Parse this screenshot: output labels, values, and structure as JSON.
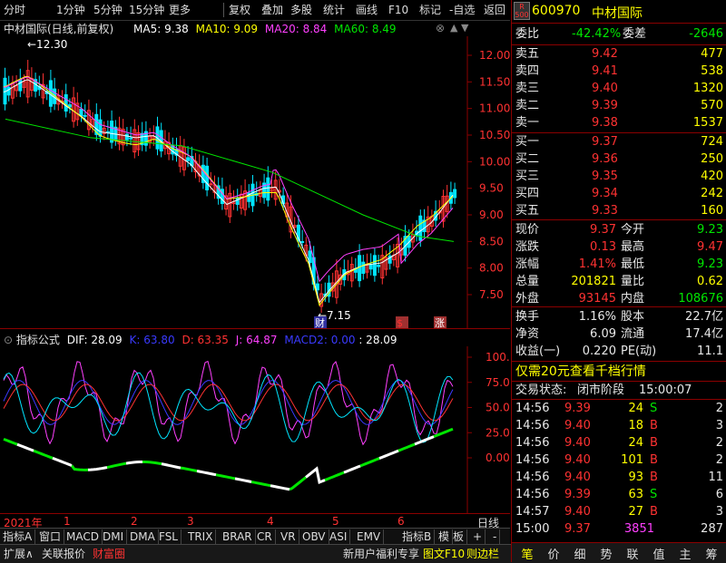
{
  "toolbar": {
    "items": [
      "分时",
      "1分钟",
      "5分钟",
      "15分钟",
      "更多",
      "复权",
      "叠加",
      "多股",
      "统计",
      "画线",
      "F10",
      "标记",
      "-自选",
      "返回"
    ]
  },
  "chart": {
    "title": "中材国际(日线,前复权)",
    "ma5_label": "MA5: 9.38",
    "ma10_label": "MA10: 9.09",
    "ma20_label": "MA20: 8.84",
    "ma60_label": "MA60: 8.49",
    "high_mark": "12.30",
    "low_mark": "7.15",
    "price_axis": [
      "12.00",
      "11.50",
      "11.00",
      "10.50",
      "10.00",
      "9.50",
      "9.00",
      "8.50",
      "8.00",
      "7.50"
    ],
    "markers": [
      "财",
      "$",
      "涨"
    ],
    "colors": {
      "up": "#ff3232",
      "down": "#00e5ff",
      "ma5": "#ffffff",
      "ma10": "#ffff00",
      "ma20": "#ff40ff",
      "ma60": "#00e600"
    }
  },
  "indicator": {
    "title": "指标公式",
    "dif_label": "DIF: 28.09",
    "k_label": "K: 63.80",
    "d_label": "D: 63.35",
    "j_label": "J: 64.87",
    "macd2_label": "MACD2: 0.00",
    "last_label": ": 28.09",
    "axis": [
      "100.0",
      "75.00",
      "50.00",
      "25.00",
      "0.00"
    ]
  },
  "time_axis": {
    "year": "2021年",
    "months": [
      "1",
      "2",
      "3",
      "4",
      "5",
      "6"
    ],
    "right_label": "日线"
  },
  "tabs": [
    "指标A",
    "窗口",
    "MACD",
    "DMI",
    "DMA",
    "FSL",
    "TRIX",
    "BRAR",
    "CR",
    "VR",
    "OBV",
    "ASI",
    "EMV",
    "指标B",
    "模",
    "板",
    "+",
    "-"
  ],
  "status_bar": {
    "left": [
      "扩展∧",
      "关联报价",
      "财富圈"
    ],
    "right": [
      "新用户福利专享",
      "图文F10",
      "则边栏"
    ]
  },
  "quote": {
    "code_badge_top": "R",
    "code_badge_bottom": "500",
    "code": "600970",
    "name": "中材国际",
    "weibi_label": "委比",
    "weibi_value": "-42.42%",
    "weicha_label": "委差",
    "weicha_value": "-2646",
    "asks": [
      {
        "label": "卖五",
        "price": "9.42",
        "vol": "477"
      },
      {
        "label": "卖四",
        "price": "9.41",
        "vol": "538"
      },
      {
        "label": "卖三",
        "price": "9.40",
        "vol": "1320"
      },
      {
        "label": "卖二",
        "price": "9.39",
        "vol": "570"
      },
      {
        "label": "卖一",
        "price": "9.38",
        "vol": "1537"
      }
    ],
    "bids": [
      {
        "label": "买一",
        "price": "9.37",
        "vol": "724"
      },
      {
        "label": "买二",
        "price": "9.36",
        "vol": "250"
      },
      {
        "label": "买三",
        "price": "9.35",
        "vol": "420"
      },
      {
        "label": "买四",
        "price": "9.34",
        "vol": "242"
      },
      {
        "label": "买五",
        "price": "9.33",
        "vol": "160"
      }
    ],
    "stats": [
      {
        "l1": "现价",
        "v1": "9.37",
        "l2": "今开",
        "v2": "9.23",
        "c1": "red",
        "c2": "green"
      },
      {
        "l1": "涨跌",
        "v1": "0.13",
        "l2": "最高",
        "v2": "9.47",
        "c1": "red",
        "c2": "red"
      },
      {
        "l1": "涨幅",
        "v1": "1.41%",
        "l2": "最低",
        "v2": "9.23",
        "c1": "red",
        "c2": "green"
      },
      {
        "l1": "总量",
        "v1": "201821",
        "l2": "量比",
        "v2": "0.62",
        "c1": "yellow",
        "c2": "yellow"
      },
      {
        "l1": "外盘",
        "v1": "93145",
        "l2": "内盘",
        "v2": "108676",
        "c1": "red",
        "c2": "green"
      }
    ],
    "stats2": [
      {
        "l1": "换手",
        "v1": "1.16%",
        "l2": "股本",
        "v2": "22.7亿"
      },
      {
        "l1": "净资",
        "v1": "6.09",
        "l2": "流通",
        "v2": "17.4亿"
      },
      {
        "l1": "收益(一)",
        "v1": "0.220",
        "l2": "PE(动)",
        "v2": "11.1"
      }
    ],
    "promo": "仅需20元查看千档行情",
    "trade_status_label": "交易状态:",
    "trade_status": "闭市阶段",
    "trade_time": "15:00:07",
    "ticks": [
      {
        "t": "14:56",
        "p": "9.39",
        "v": "24",
        "s": "S",
        "n": "2"
      },
      {
        "t": "14:56",
        "p": "9.40",
        "v": "18",
        "s": "B",
        "n": "3"
      },
      {
        "t": "14:56",
        "p": "9.40",
        "v": "24",
        "s": "B",
        "n": "2"
      },
      {
        "t": "14:56",
        "p": "9.40",
        "v": "101",
        "s": "B",
        "n": "2"
      },
      {
        "t": "14:56",
        "p": "9.40",
        "v": "93",
        "s": "B",
        "n": "11"
      },
      {
        "t": "14:56",
        "p": "9.39",
        "v": "63",
        "s": "S",
        "n": "6"
      },
      {
        "t": "14:57",
        "p": "9.40",
        "v": "27",
        "s": "B",
        "n": "3"
      },
      {
        "t": "15:00",
        "p": "9.37",
        "v": "3851",
        "s": "",
        "n": "287"
      }
    ],
    "bottom_tabs": [
      "笔",
      "价",
      "细",
      "势",
      "联",
      "值",
      "主",
      "筹"
    ]
  }
}
